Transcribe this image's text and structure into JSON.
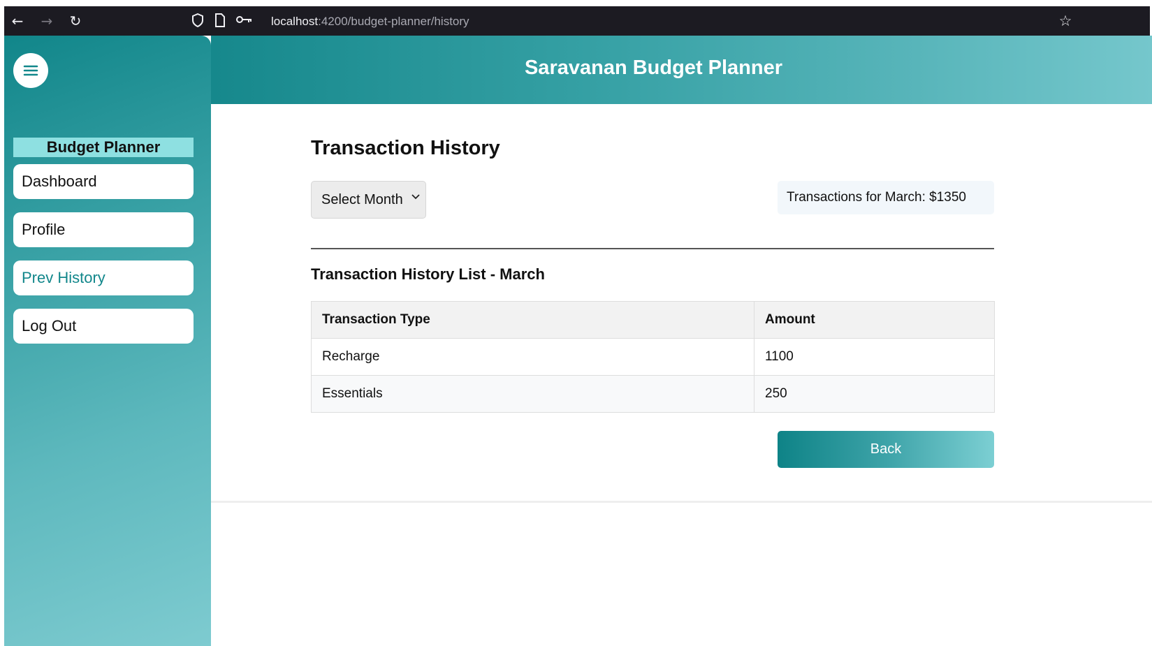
{
  "browser": {
    "back_icon": "←",
    "forward_icon": "→",
    "reload_icon": "↻",
    "shield_icon": "shield-icon",
    "page_icon": "page-icon",
    "key_icon": "key-icon",
    "url_host": "localhost",
    "url_rest": ":4200/budget-planner/history",
    "star_icon": "☆"
  },
  "header": {
    "title": "Saravanan Budget Planner"
  },
  "sidebar": {
    "menu_icon": "hamburger-icon",
    "heading": "Budget Planner",
    "items": [
      {
        "label": "Dashboard",
        "active": false
      },
      {
        "label": "Profile",
        "active": false
      },
      {
        "label": "Prev History",
        "active": true
      },
      {
        "label": "Log Out",
        "active": false
      }
    ]
  },
  "main": {
    "title": "Transaction History",
    "month_select": {
      "selected": "Select Month",
      "chevron": "⌄"
    },
    "summary": "Transactions for March: $1350",
    "list_title": "Transaction History List - March",
    "table": {
      "headers": [
        "Transaction Type",
        "Amount"
      ],
      "rows": [
        [
          "Recharge",
          "1100"
        ],
        [
          "Essentials",
          "250"
        ]
      ]
    },
    "back_label": "Back"
  },
  "colors": {
    "accent": "#12878b",
    "sidebar_heading_bg": "#8ee0e1",
    "header_gradient_start": "#16888c",
    "header_gradient_end": "#75c7cc"
  }
}
